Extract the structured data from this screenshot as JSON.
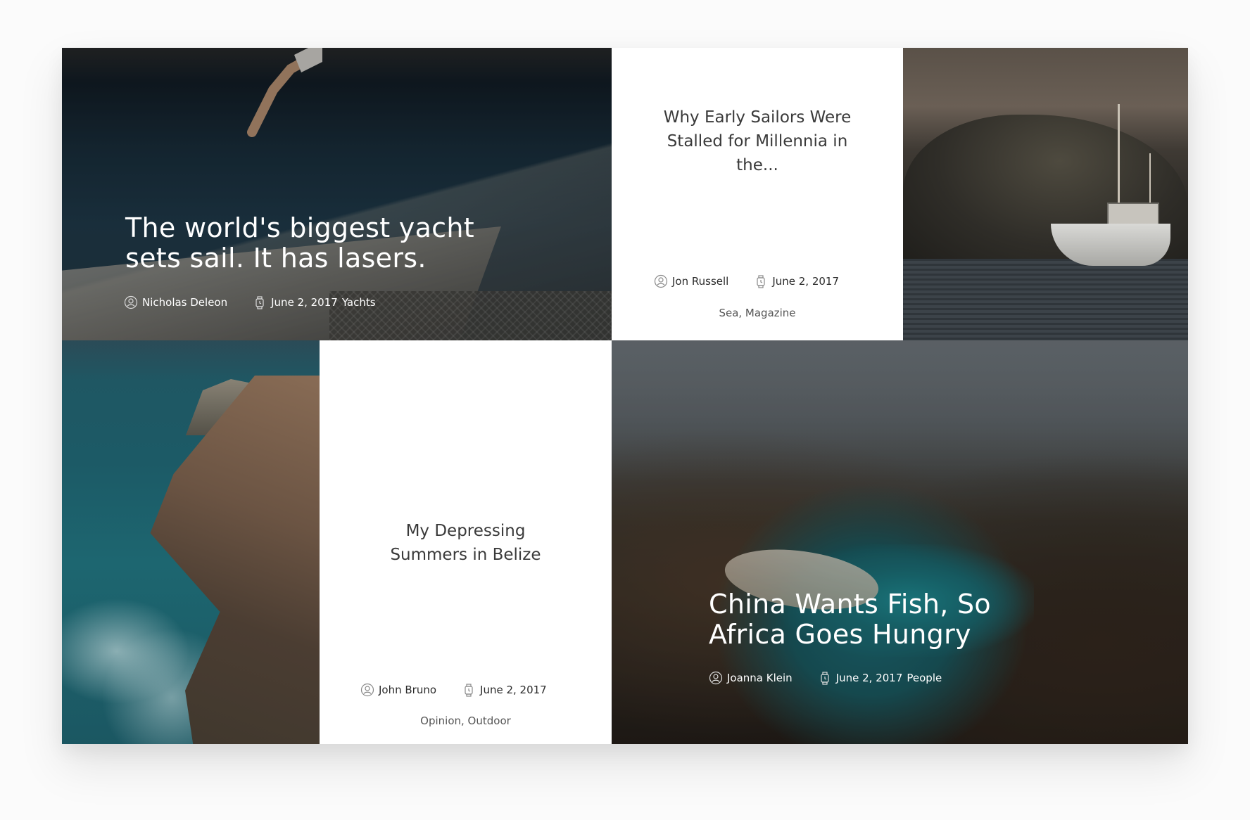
{
  "posts": [
    {
      "title": "The world's biggest yacht sets sail. It has lasers.",
      "author": "Nicholas Deleon",
      "date": "June 2, 2017",
      "category": "Yachts"
    },
    {
      "title": "Why Early Sailors Were Stalled for Millennia in the...",
      "author": "Jon Russell",
      "date": "June 2, 2017",
      "tags": "Sea, Magazine"
    },
    {
      "title": "My Depressing Summers in Belize",
      "author": "John Bruno",
      "date": "June 2, 2017",
      "tags": "Opinion, Outdoor"
    },
    {
      "title": "China Wants Fish, So Africa Goes Hungry",
      "author": "Joanna Klein",
      "date": "June 2, 2017",
      "category": "People"
    }
  ],
  "icons": {
    "author": "user-circle-icon",
    "date": "watch-icon"
  }
}
